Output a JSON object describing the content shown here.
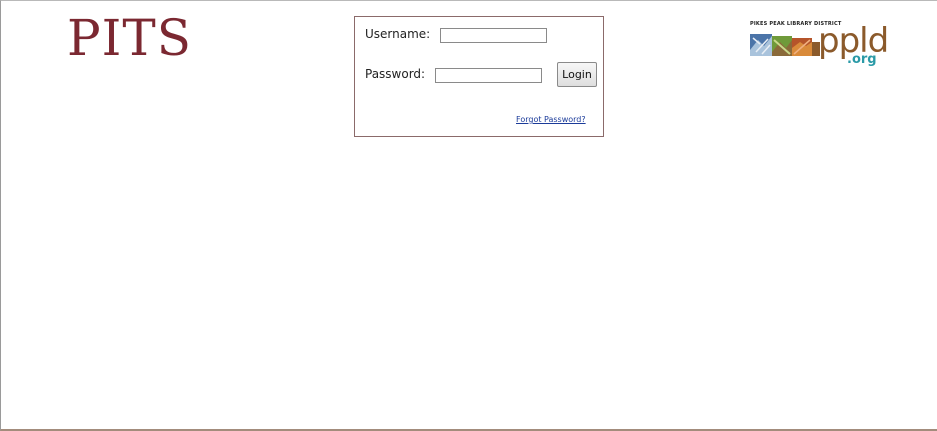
{
  "header": {
    "app_title": "PITS"
  },
  "login": {
    "username_label": "Username:",
    "username_value": "",
    "password_label": "Password:",
    "password_value": "",
    "login_button": "Login",
    "forgot_password": "Forgot Password?"
  },
  "logo": {
    "org_name": "PIKES PEAK LIBRARY DISTRICT",
    "wordmark": "ppld",
    "domain": ".org"
  },
  "colors": {
    "title": "#7b2831",
    "box_border": "#8b6a6a",
    "link": "#1b3b9a",
    "logo_wordmark": "#8b5a2b",
    "logo_domain": "#2a9aa7"
  }
}
